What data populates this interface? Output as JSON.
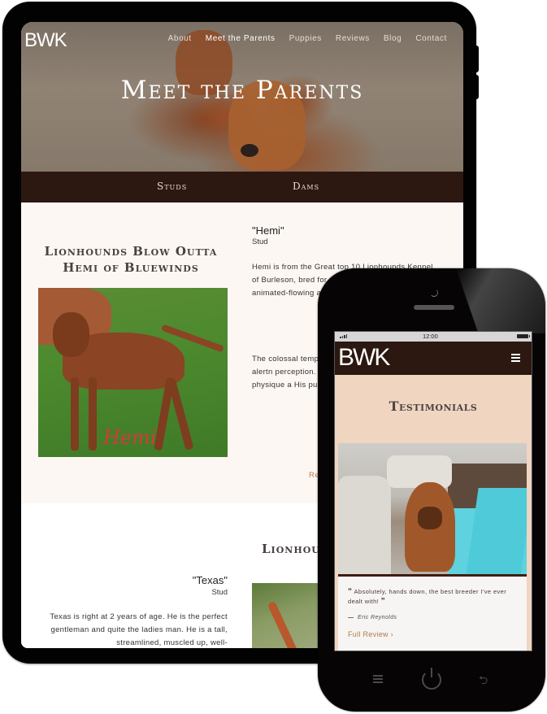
{
  "tablet": {
    "logo": "BWK",
    "nav": [
      {
        "label": "About",
        "active": false
      },
      {
        "label": "Meet the Parents",
        "active": true
      },
      {
        "label": "Puppies",
        "active": false
      },
      {
        "label": "Reviews",
        "active": false
      },
      {
        "label": "Blog",
        "active": false
      },
      {
        "label": "Contact",
        "active": false
      }
    ],
    "hero_title": "Meet the Parents",
    "subnav": {
      "studs": "Studs",
      "dams": "Dams"
    },
    "dogs": [
      {
        "title": "Lionhounds Blow Outta Hemi of Bluewinds",
        "photo_caption": "Hemi",
        "name": "\"Hemi\"",
        "role": "Stud",
        "paragraphs": [
          "Hemi is from the Great top 10 Lionhounds Kennel of Burleson, bred for extraordi ridge and whirls, animated-flowing after in the great",
          "The colossal temp offspring exhibit gentleness, alertn perception. Hemi offspring displaye pound physique a His puppies flaun by their sire."
        ],
        "read_more": "Rea"
      },
      {
        "title": "Lionhou C",
        "name": "\"Texas\"",
        "role": "Stud",
        "paragraphs": [
          "Texas is right at 2 years of age. He is the perfect gentleman and quite the ladies man. He is a tall, streamlined, muscled up, well-"
        ]
      }
    ]
  },
  "phone": {
    "status": {
      "time": "12:00"
    },
    "logo": "BWK",
    "section_title": "Testimonials",
    "testimonial": {
      "open_quote": "“",
      "quote": "Absolutely, hands down, the best breeder I've ever dealt with!",
      "close_quote": "”",
      "author": "Eric Reynolds",
      "link": "Full Review ›"
    },
    "hardware_buttons": [
      "menu-icon",
      "power-icon",
      "back-icon"
    ],
    "back_glyph": "⮌"
  }
}
